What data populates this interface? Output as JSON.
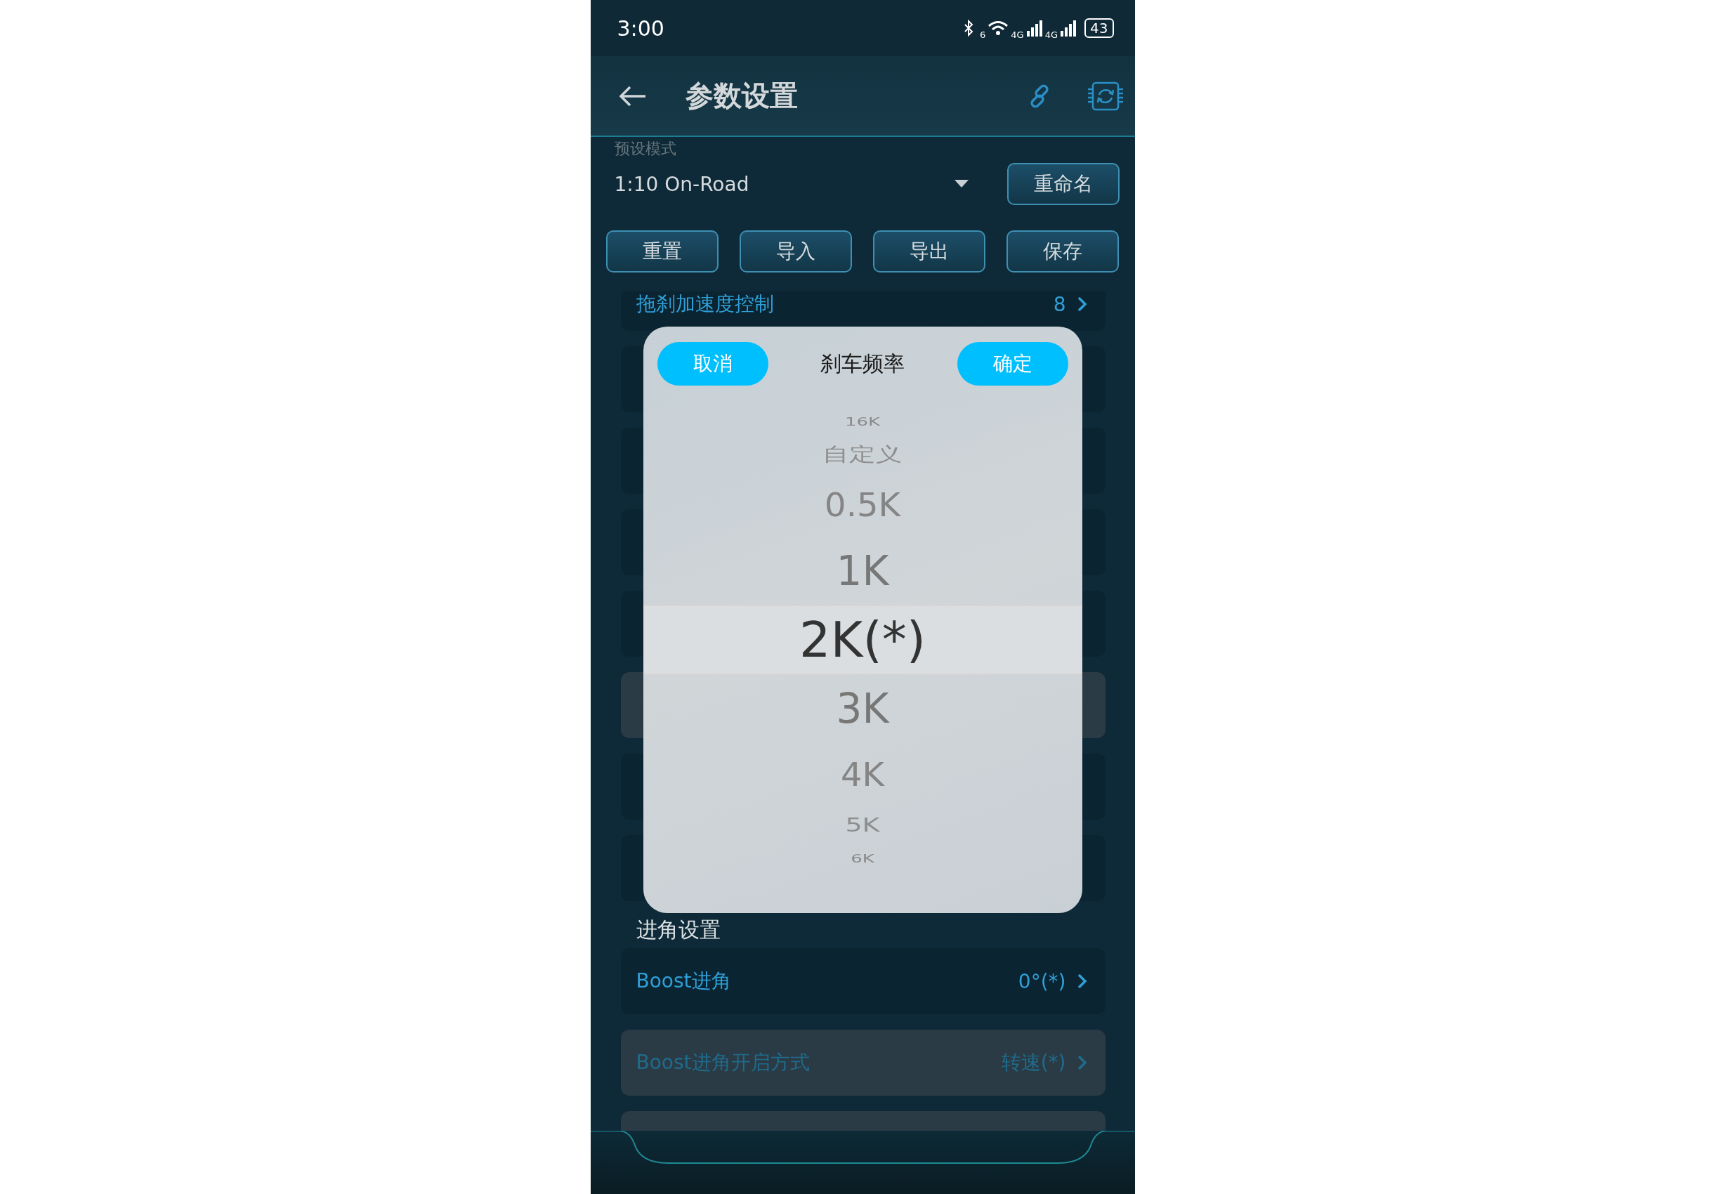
{
  "status_bar": {
    "time": "3:00",
    "wifi_label": "6",
    "signal_labels": [
      "4G",
      "4G"
    ],
    "battery": "43"
  },
  "header": {
    "title": "参数设置"
  },
  "preset": {
    "label": "预设模式",
    "value": "1:10 On-Road",
    "rename_button": "重命名"
  },
  "actions": [
    "重置",
    "导入",
    "导出",
    "保存"
  ],
  "rows_before": [
    {
      "label": "拖刹加速度控制",
      "value": "8",
      "disabled": false
    }
  ],
  "covered_rows": [
    {
      "disabled": false
    },
    {
      "disabled": false
    },
    {
      "disabled": false
    },
    {
      "disabled": false
    },
    {
      "disabled": true
    },
    {
      "disabled": false
    },
    {
      "disabled": false
    }
  ],
  "section_title": "进角设置",
  "rows_after": [
    {
      "label": "Boost进角",
      "value": "0°(*)",
      "disabled": false
    },
    {
      "label": "Boost进角开启方式",
      "value": "转速(*)",
      "disabled": true
    },
    {
      "disabled": true
    }
  ],
  "picker": {
    "cancel": "取消",
    "title": "刹车频率",
    "confirm": "确定",
    "options": [
      {
        "label": "16K",
        "selected": false
      },
      {
        "label": "自定义",
        "selected": false
      },
      {
        "label": "0.5K",
        "selected": false
      },
      {
        "label": "1K",
        "selected": false
      },
      {
        "label": "2K(*)",
        "selected": true
      },
      {
        "label": "3K",
        "selected": false
      },
      {
        "label": "4K",
        "selected": false
      },
      {
        "label": "5K",
        "selected": false
      },
      {
        "label": "6K",
        "selected": false
      }
    ]
  }
}
